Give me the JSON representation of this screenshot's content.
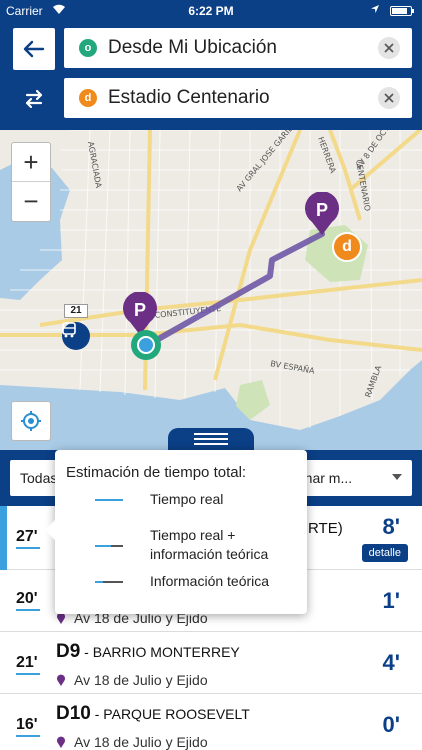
{
  "status_bar": {
    "carrier": "Carrier",
    "time": "6:22 PM",
    "battery_level": 0.85
  },
  "route": {
    "origin": {
      "badge": "o",
      "text": "Desde Mi Ubicación"
    },
    "destination": {
      "badge": "d",
      "text": "Estadio Centenario"
    }
  },
  "map": {
    "zoom_in": "+",
    "zoom_out": "−",
    "street_labels": [
      "AV GRAL JOSE GARIBALDI",
      "AGRACIADA",
      "HERRERA",
      "AV 8 DE OCTUBRE",
      "CENTENARIO",
      "CONSTITUYENTE",
      "BV ESPAÑA",
      "RAMBLA"
    ],
    "bus_stop_number": "21",
    "markers": {
      "parking": "P",
      "destination": "d"
    }
  },
  "filters": {
    "left": "Todas",
    "right": "Caminar m..."
  },
  "legend": {
    "title": "Estimación de tiempo total:",
    "items": [
      {
        "label": "Tiempo real",
        "colors": [
          "#3aa0de"
        ]
      },
      {
        "label": "Tiempo real + información teórica",
        "label_line1": "Tiempo real +",
        "label_line2": "información teórica",
        "colors": [
          "#3aa0de",
          "#555555"
        ]
      },
      {
        "label": "Información teórica",
        "colors": [
          "#3aa0de",
          "#555555"
        ]
      }
    ]
  },
  "results": [
    {
      "minutes": "27'",
      "title_partial": "RTE)",
      "count": "8'",
      "detail": "detalle"
    },
    {
      "minutes": "20'",
      "stop": "Av 18 de Julio y Ejido",
      "count": "1'"
    },
    {
      "minutes": "21'",
      "line": "D9",
      "destination": " - BARRIO MONTERREY",
      "stop": "Av 18 de Julio y Ejido",
      "count": "4'"
    },
    {
      "minutes": "16'",
      "line": "D10",
      "destination": " - PARQUE ROOSEVELT",
      "stop": "Av 18 de Julio y Ejido",
      "count": "0'"
    }
  ],
  "colors": {
    "brand": "#0b3f86",
    "origin": "#22a87c",
    "destination": "#f08a1c",
    "parking": "#6b2f86",
    "route": "#6f58a6",
    "realtime": "#3aa0de"
  }
}
